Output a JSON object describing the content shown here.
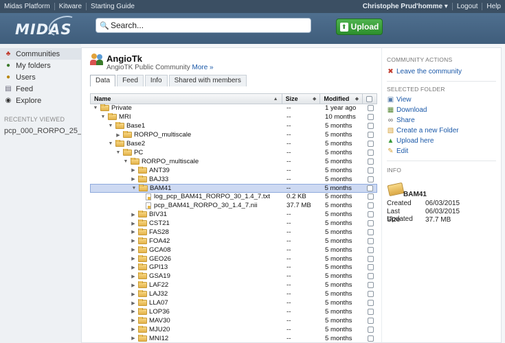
{
  "topbar": {
    "links": [
      "Midas Platform",
      "Kitware",
      "Starting Guide"
    ],
    "user": "Christophe Prud'homme ▾",
    "logout": "Logout",
    "help": "Help"
  },
  "header": {
    "logo": "MIDAS",
    "search_placeholder": "Search...",
    "upload_label": "Upload"
  },
  "sidebar": {
    "items": [
      {
        "label": "Communities",
        "icon": "communities-icon"
      },
      {
        "label": "My folders",
        "icon": "user-icon"
      },
      {
        "label": "Users",
        "icon": "users-icon"
      },
      {
        "label": "Feed",
        "icon": "feed-icon"
      },
      {
        "label": "Explore",
        "icon": "binoculars-icon"
      }
    ],
    "recent_heading": "RECENTLY VIEWED",
    "recent_items": [
      "pcp_000_RORPO_25_..."
    ]
  },
  "community": {
    "title": "AngioTk",
    "subtitle": "AngioTK Public Community",
    "more_link": "More »"
  },
  "tabs": [
    "Data",
    "Feed",
    "Info",
    "Shared with members"
  ],
  "table": {
    "headers": {
      "name": "Name",
      "size": "Size",
      "modified": "Modified"
    },
    "rows": [
      {
        "name": "Private",
        "size": "--",
        "modified": "1 year ago"
      },
      {
        "name": "MRI",
        "size": "--",
        "modified": "10 months"
      },
      {
        "name": "Base1",
        "size": "--",
        "modified": "5 months"
      },
      {
        "name": "RORPO_multiscale",
        "size": "--",
        "modified": "5 months"
      },
      {
        "name": "Base2",
        "size": "--",
        "modified": "5 months"
      },
      {
        "name": "PC",
        "size": "--",
        "modified": "5 months"
      },
      {
        "name": "RORPO_multiscale",
        "size": "--",
        "modified": "5 months"
      },
      {
        "name": "ANT39",
        "size": "--",
        "modified": "5 months"
      },
      {
        "name": "BAJ33",
        "size": "--",
        "modified": "5 months"
      },
      {
        "name": "BAM41",
        "size": "--",
        "modified": "5 months"
      },
      {
        "name": "log_pcp_BAM41_RORPO_30_1.4_7.txt",
        "size": "0.2 KB",
        "modified": "5 months"
      },
      {
        "name": "pcp_BAM41_RORPO_30_1.4_7.nii",
        "size": "37.7 MB",
        "modified": "5 months"
      },
      {
        "name": "BIV31",
        "size": "--",
        "modified": "5 months"
      },
      {
        "name": "CST21",
        "size": "--",
        "modified": "5 months"
      },
      {
        "name": "FAS28",
        "size": "--",
        "modified": "5 months"
      },
      {
        "name": "FOA42",
        "size": "--",
        "modified": "5 months"
      },
      {
        "name": "GCA08",
        "size": "--",
        "modified": "5 months"
      },
      {
        "name": "GEO26",
        "size": "--",
        "modified": "5 months"
      },
      {
        "name": "GPI13",
        "size": "--",
        "modified": "5 months"
      },
      {
        "name": "GSA19",
        "size": "--",
        "modified": "5 months"
      },
      {
        "name": "LAF22",
        "size": "--",
        "modified": "5 months"
      },
      {
        "name": "LAJ32",
        "size": "--",
        "modified": "5 months"
      },
      {
        "name": "LLA07",
        "size": "--",
        "modified": "5 months"
      },
      {
        "name": "LOP36",
        "size": "--",
        "modified": "5 months"
      },
      {
        "name": "MAV30",
        "size": "--",
        "modified": "5 months"
      },
      {
        "name": "MJU20",
        "size": "--",
        "modified": "5 months"
      },
      {
        "name": "MNI12",
        "size": "--",
        "modified": "5 months"
      }
    ]
  },
  "right": {
    "community_actions_heading": "COMMUNITY ACTIONS",
    "leave_label": "Leave the community",
    "selected_folder_heading": "SELECTED FOLDER",
    "folder_actions": [
      {
        "label": "View",
        "icon": "view-icon"
      },
      {
        "label": "Download",
        "icon": "download-icon"
      },
      {
        "label": "Share",
        "icon": "share-icon"
      },
      {
        "label": "Create a new Folder",
        "icon": "new-folder-icon"
      },
      {
        "label": "Upload here",
        "icon": "upload-icon"
      },
      {
        "label": "Edit",
        "icon": "edit-icon"
      }
    ],
    "info_heading": "INFO",
    "info": {
      "name": "BAM41",
      "created_label": "Created",
      "created_value": "06/03/2015",
      "updated_label": "Last Updated",
      "updated_value": "06/03/2015",
      "size_label": "Size",
      "size_value": "37.7 MB"
    }
  },
  "colors": {
    "topbar": "#3b4f63",
    "header": "#4a6888",
    "upload_green": "#3aa03a",
    "link_blue": "#1a58a8",
    "selection": "#cdd9f2"
  }
}
